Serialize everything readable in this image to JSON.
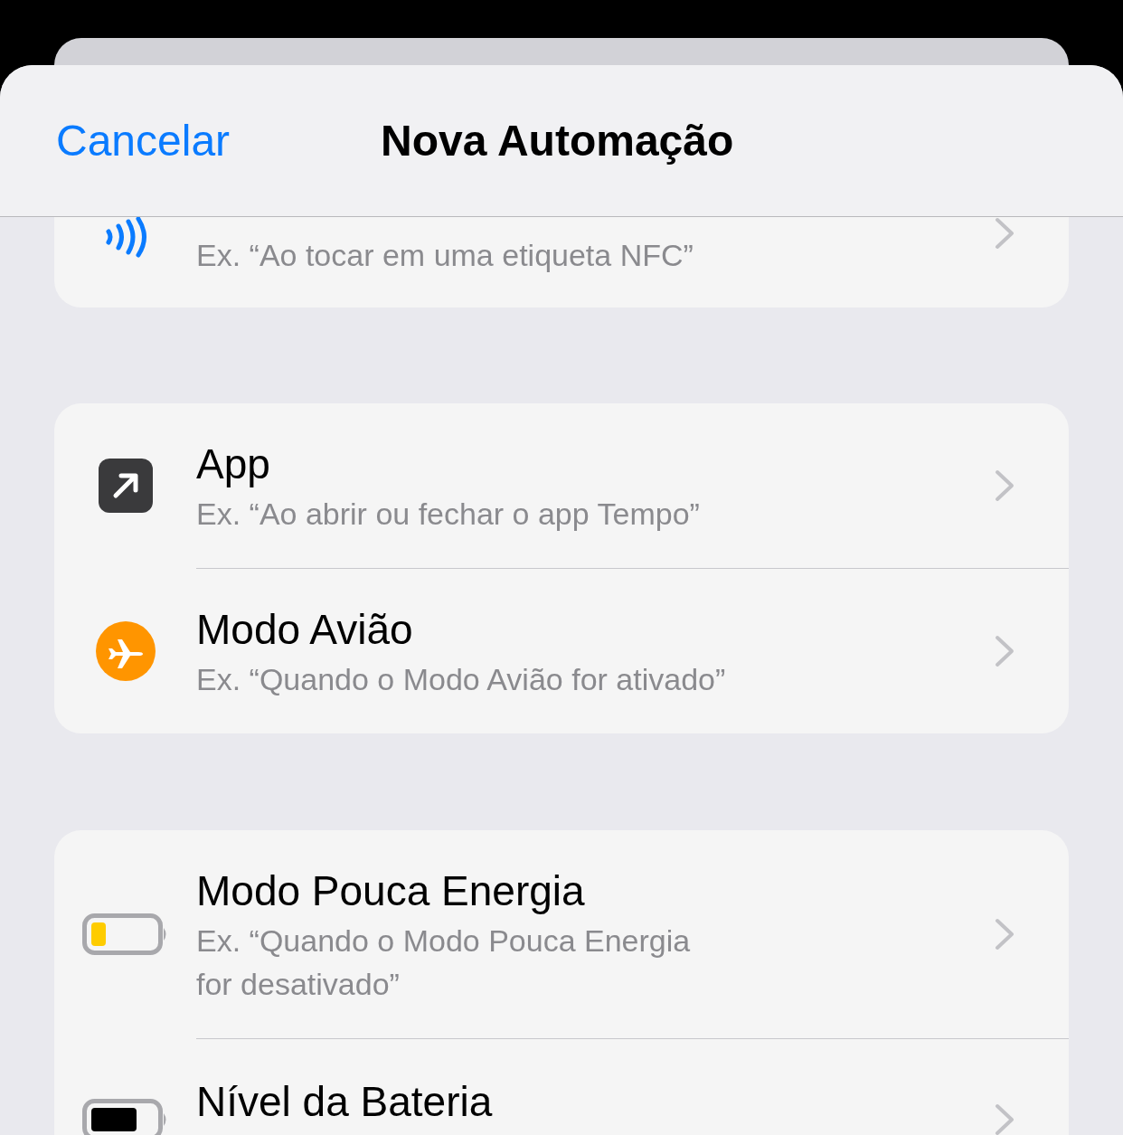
{
  "header": {
    "cancel": "Cancelar",
    "title": "Nova Automação"
  },
  "sections": [
    {
      "items": [
        {
          "kind": "nfc",
          "subtitle": "Ex. “Ao tocar em uma etiqueta NFC”"
        }
      ]
    },
    {
      "items": [
        {
          "kind": "app",
          "title": "App",
          "subtitle": "Ex. “Ao abrir ou fechar o app Tempo”"
        },
        {
          "kind": "airplane",
          "title": "Modo Avião",
          "subtitle": "Ex. “Quando o Modo Avião for ativado”"
        }
      ]
    },
    {
      "items": [
        {
          "kind": "battery-low",
          "title": "Modo Pouca Energia",
          "subtitle": "Ex. “Quando o Modo Pouca Energia\nfor desativado”"
        },
        {
          "kind": "battery",
          "title": "Nível da Bateria"
        }
      ]
    }
  ]
}
